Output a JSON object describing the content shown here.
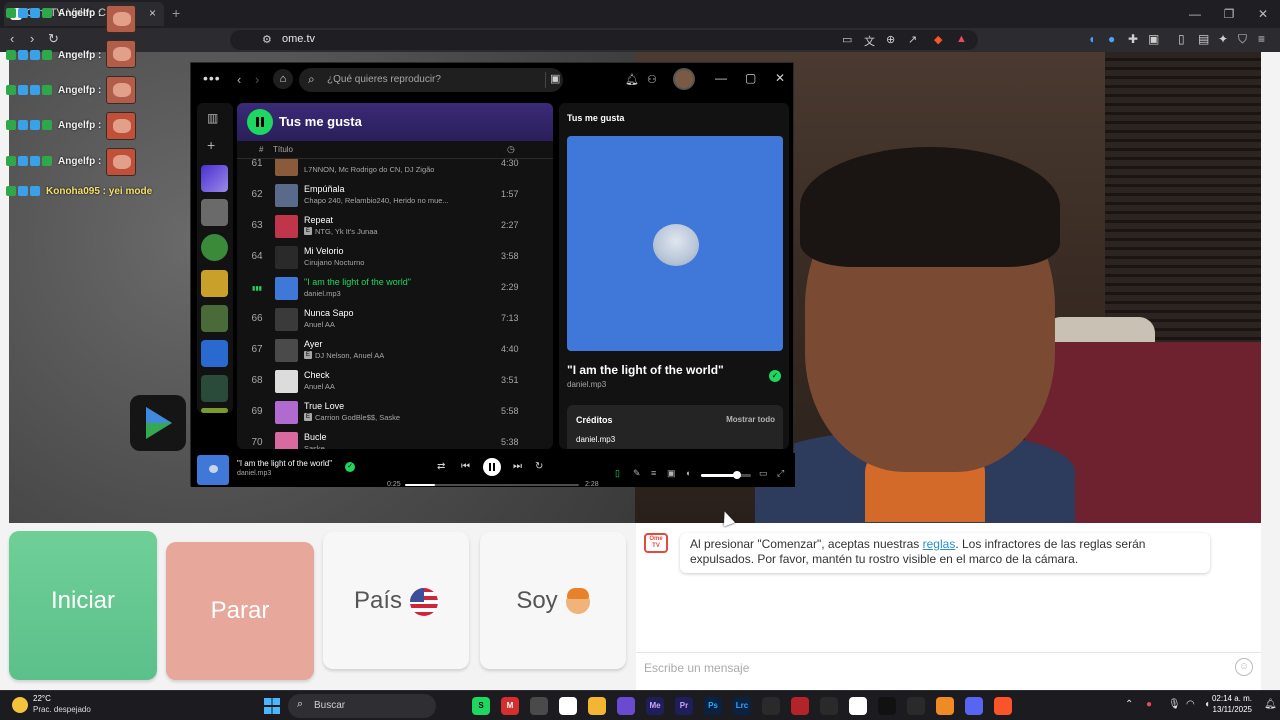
{
  "browser": {
    "tab_title": "OmeTV Video Chat",
    "tab_close": "×",
    "new_tab": "+",
    "url": "ome.tv",
    "window_controls": {
      "minimize": "—",
      "restore": "❐",
      "close": "✕"
    }
  },
  "overlay_chat": [
    {
      "name": "Angelfp :",
      "message": ""
    },
    {
      "name": "Angelfp :",
      "message": ""
    },
    {
      "name": "Angelfp :",
      "message": ""
    },
    {
      "name": "Angelfp :",
      "message": ""
    },
    {
      "name": "Angelfp :",
      "message": ""
    },
    {
      "name": "Konoha095 : yei mode",
      "message": ""
    }
  ],
  "spotify": {
    "search_placeholder": "¿Qué quieres reproducir?",
    "playlist_title": "Tus me gusta",
    "col_title": "Título",
    "col_hash": "#",
    "tracks": [
      {
        "num": "61",
        "title": "",
        "artist": "L7NNON, Mc Rodrigo do CN, DJ Zigão",
        "duration": "4:30",
        "explicit": false,
        "art": "#8a5a3a"
      },
      {
        "num": "62",
        "title": "Empúñala",
        "artist": "Chapo 240, Relambio240, Herido no mue...",
        "duration": "1:57",
        "explicit": false,
        "art": "#5a6a8a"
      },
      {
        "num": "63",
        "title": "Repeat",
        "artist": "NTG, Yk It's Junaa",
        "duration": "2:27",
        "explicit": true,
        "art": "#c0354a"
      },
      {
        "num": "64",
        "title": "Mi Velorio",
        "artist": "Cirujano Nocturno",
        "duration": "3:58",
        "explicit": false,
        "art": "#2a2a2a"
      },
      {
        "num": "",
        "title": "\"I am the light of the world\"",
        "artist": "daniel.mp3",
        "duration": "2:29",
        "explicit": false,
        "art": "#3f78d9",
        "active": true
      },
      {
        "num": "66",
        "title": "Nunca Sapo",
        "artist": "Anuel AA",
        "duration": "7:13",
        "explicit": false,
        "art": "#3a3a3a"
      },
      {
        "num": "67",
        "title": "Ayer",
        "artist": "DJ Nelson, Anuel AA",
        "duration": "4:40",
        "explicit": true,
        "art": "#4a4a4a"
      },
      {
        "num": "68",
        "title": "Check",
        "artist": "Anuel AA",
        "duration": "3:51",
        "explicit": false,
        "art": "#dcdcdc"
      },
      {
        "num": "69",
        "title": "True Love",
        "artist": "Carrion GodBle$$, Saske",
        "duration": "5:58",
        "explicit": true,
        "art": "#b06ad0"
      },
      {
        "num": "70",
        "title": "Bucle",
        "artist": "Saske",
        "duration": "5:38",
        "explicit": false,
        "art": "#d86aa0"
      }
    ],
    "now_playing_label": "Tus me gusta",
    "now_playing_title": "\"I am the light of the world\"",
    "now_playing_artist": "daniel.mp3",
    "credits_title": "Créditos",
    "credits_more": "Mostrar todo",
    "credits_name": "daniel.mp3",
    "bar_title": "\"I am the light of the world\"",
    "bar_artist": "daniel.mp3",
    "time_elapsed": "0:25",
    "time_total": "2:28",
    "progress_fraction": 0.17,
    "volume_fraction": 0.72
  },
  "controls": {
    "start": "Iniciar",
    "stop": "Parar",
    "country": "País",
    "gender": "Soy"
  },
  "chat": {
    "logo": "Ome TV",
    "message_pre": "Al presionar \"Comenzar\", aceptas nuestras ",
    "message_link": "reglas",
    "message_post": ". Los infractores de las reglas serán expulsados. Por favor, mantén tu rostro visible en el marco de la cámara.",
    "input_placeholder": "Escribe un mensaje"
  },
  "taskbar": {
    "weather_temp": "22°C",
    "weather_desc": "Prac. despejado",
    "search_label": "Buscar",
    "time": "02:14 a. m.",
    "date": "13/11/2025",
    "apps": [
      {
        "label": "S",
        "color": "#1ed760",
        "text": "#000"
      },
      {
        "label": "M",
        "color": "#d32f2f",
        "text": "#fff"
      },
      {
        "label": "",
        "color": "#4a4a4a",
        "text": "#fff"
      },
      {
        "label": "",
        "color": "#ffffff",
        "text": "#000"
      },
      {
        "label": "",
        "color": "#f2b632",
        "text": "#000"
      },
      {
        "label": "",
        "color": "#6a4ad0",
        "text": "#fff"
      },
      {
        "label": "Me",
        "color": "#1e1e5a",
        "text": "#c9a2ff"
      },
      {
        "label": "Pr",
        "color": "#1e1e5a",
        "text": "#c9a2ff"
      },
      {
        "label": "Ps",
        "color": "#0a2140",
        "text": "#31a8ff"
      },
      {
        "label": "Lrc",
        "color": "#0a2140",
        "text": "#31a8ff"
      },
      {
        "label": "",
        "color": "#2a2a2a",
        "text": "#fff"
      },
      {
        "label": "",
        "color": "#b5232a",
        "text": "#fff"
      },
      {
        "label": "",
        "color": "#2a2a2a",
        "text": "#fff"
      },
      {
        "label": "",
        "color": "#ffffff",
        "text": "#000"
      },
      {
        "label": "",
        "color": "#111111",
        "text": "#fff"
      },
      {
        "label": "",
        "color": "#2a2a2a",
        "text": "#fff"
      },
      {
        "label": "",
        "color": "#f08a24",
        "text": "#fff"
      },
      {
        "label": "",
        "color": "#5865f2",
        "text": "#fff"
      },
      {
        "label": "",
        "color": "#fb542b",
        "text": "#fff"
      }
    ]
  }
}
